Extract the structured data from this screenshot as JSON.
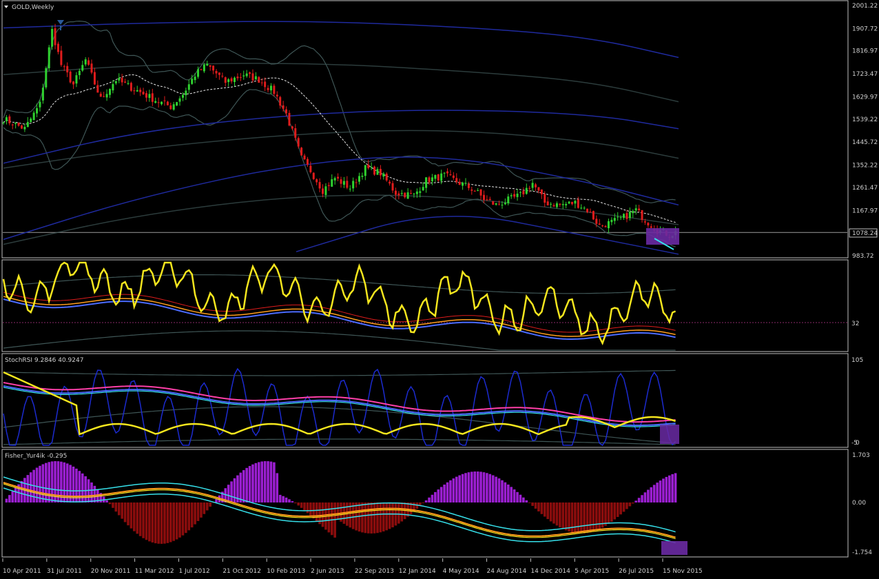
{
  "window": {
    "symbol_label": "GOLD,Weekly"
  },
  "colors": {
    "background": "#000000",
    "frame": "#c0c0c0",
    "bull_candle": "#2fd12f",
    "bear_candle": "#e01c1c",
    "band_blue": "#1f2a9e",
    "band_gray": "#3f5656",
    "yellow": "#f5e61e",
    "magenta": "#ff3fa8",
    "cyan": "#36e0ea",
    "orange": "#ff9d1a",
    "hist_pos": "#9b1fd1",
    "hist_neg": "#8b0d0d",
    "highlight_box": "#6a2aa3"
  },
  "chart_data": [
    {
      "id": "price",
      "type": "candlestick",
      "title": "GOLD,Weekly",
      "y_ticks": [
        "2001.22",
        "1907.72",
        "1816.97",
        "1723.47",
        "1629.97",
        "1539.22",
        "1445.72",
        "1352.22",
        "1261.47",
        "1167.97"
      ],
      "y_range": [
        983.72,
        2001.22
      ],
      "current_price_label": "1078.24",
      "current_price": 1078.24,
      "bottom_tick": "983.72",
      "approx_weekly_close_path": [
        [
          1,
          1540
        ],
        [
          8,
          1500
        ],
        [
          13,
          1600
        ],
        [
          17,
          1900
        ],
        [
          20,
          1760
        ],
        [
          24,
          1680
        ],
        [
          28,
          1780
        ],
        [
          33,
          1620
        ],
        [
          38,
          1700
        ],
        [
          45,
          1655
        ],
        [
          52,
          1610
        ],
        [
          56,
          1590
        ],
        [
          60,
          1640
        ],
        [
          64,
          1720
        ],
        [
          68,
          1760
        ],
        [
          74,
          1690
        ],
        [
          80,
          1720
        ],
        [
          85,
          1700
        ],
        [
          90,
          1650
        ],
        [
          94,
          1560
        ],
        [
          99,
          1380
        ],
        [
          102,
          1330
        ],
        [
          106,
          1250
        ],
        [
          110,
          1300
        ],
        [
          115,
          1260
        ],
        [
          120,
          1340
        ],
        [
          125,
          1320
        ],
        [
          130,
          1240
        ],
        [
          136,
          1230
        ],
        [
          140,
          1290
        ],
        [
          146,
          1310
        ],
        [
          151,
          1280
        ],
        [
          156,
          1250
        ],
        [
          159,
          1215
        ],
        [
          163,
          1190
        ],
        [
          167,
          1210
        ],
        [
          171,
          1230
        ],
        [
          175,
          1280
        ],
        [
          179,
          1200
        ],
        [
          184,
          1190
        ],
        [
          189,
          1200
        ],
        [
          193,
          1170
        ],
        [
          197,
          1105
        ],
        [
          201,
          1120
        ],
        [
          205,
          1140
        ],
        [
          209,
          1170
        ],
        [
          212,
          1130
        ],
        [
          216,
          1088
        ],
        [
          220,
          1070
        ],
        [
          222,
          1078
        ]
      ]
    },
    {
      "id": "osc1",
      "type": "line",
      "level_label": "32",
      "level_value": 32
    },
    {
      "id": "stochrsi",
      "type": "line",
      "title": "StochRSI 9.2846 40.9247",
      "top_tick": "105",
      "bottom_tick": "-5",
      "bottom_tick_2": "0"
    },
    {
      "id": "fisher",
      "type": "histogram",
      "title": "Fisher_Yur4ik -0.295",
      "y_ticks": [
        "1.703",
        "0.00",
        "-1.754"
      ],
      "y_range": [
        -1.754,
        1.703
      ]
    }
  ],
  "x_axis": {
    "labels": [
      "10 Apr 2011",
      "31 Jul 2011",
      "20 Nov 2011",
      "11 Mar 2012",
      "1 Jul 2012",
      "21 Oct 2012",
      "10 Feb 2013",
      "2 Jun 2013",
      "22 Sep 2013",
      "12 Jan 2014",
      "4 May 2014",
      "24 Aug 2014",
      "14 Dec 2014",
      "5 Apr 2015",
      "26 Jul 2015",
      "15 Nov 2015"
    ]
  }
}
